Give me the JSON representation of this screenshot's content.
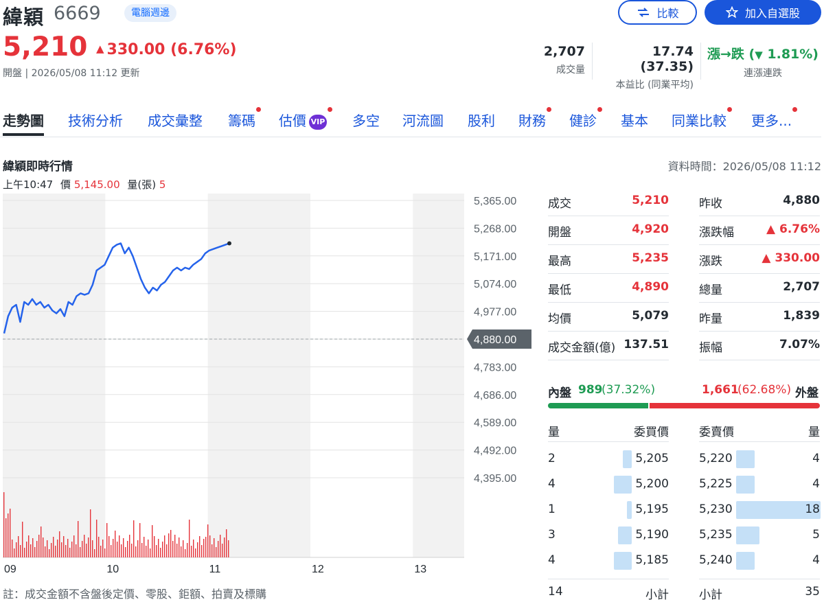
{
  "header": {
    "name": "緯穎",
    "code": "6669",
    "category": "電腦週邊",
    "price": "5,210",
    "change_arrow": "▲",
    "change": "330.00 (6.76%)",
    "open_status": "開盤 | 2026/05/08 11:12 更新",
    "compare_label": "比較",
    "watch_label": "加入自選股",
    "volume_value": "2,707",
    "volume_label": "成交量",
    "pe_value": "17.74 (37.35)",
    "pe_label": "本益比 (同業平均)",
    "streak_value_a": "漲→跌 (",
    "streak_arrow": "▼",
    "streak_value_b": " 1.81%)",
    "streak_label": "連漲連跌"
  },
  "tabs": [
    {
      "label": "走勢圖",
      "active": true,
      "dot": false
    },
    {
      "label": "技術分析",
      "dot": false
    },
    {
      "label": "成交彙整",
      "dot": false
    },
    {
      "label": "籌碼",
      "dot": true
    },
    {
      "label": "估價",
      "dot": true,
      "badge": "VIP"
    },
    {
      "label": "多空",
      "dot": false
    },
    {
      "label": "河流圖",
      "dot": false
    },
    {
      "label": "股利",
      "dot": false
    },
    {
      "label": "財務",
      "dot": true
    },
    {
      "label": "健診",
      "dot": true
    },
    {
      "label": "基本",
      "dot": false
    },
    {
      "label": "同業比較",
      "dot": true
    },
    {
      "label": "更多...",
      "dot": true
    }
  ],
  "section": {
    "title": "緯穎即時行情",
    "data_time": "資料時間：2026/05/08 11:12",
    "hover_time": "上午10:47",
    "hover_price_label": "價",
    "hover_price": "5,145.00",
    "hover_vol_label": "量(張)",
    "hover_vol": "5"
  },
  "chart_data": {
    "type": "line",
    "y_ticks": [
      "5,365.00",
      "5,268.00",
      "5,171.00",
      "5,074.00",
      "4,977.00",
      "4,880.00",
      "4,783.00",
      "4,686.00",
      "4,589.00",
      "4,492.00",
      "4,395.00"
    ],
    "x_ticks": [
      "09",
      "10",
      "11",
      "12",
      "13"
    ],
    "reference_price": 4880,
    "ylim": [
      4395,
      5365
    ],
    "line_color": "#2563eb",
    "volume_color": "#e5333a",
    "price_series": [
      4900,
      4960,
      4990,
      5000,
      4940,
      5010,
      5000,
      5020,
      5000,
      5010,
      4990,
      5000,
      4980,
      4970,
      4985,
      4960,
      5010,
      5000,
      5030,
      5040,
      5035,
      5040,
      5070,
      5120,
      5130,
      5140,
      5170,
      5200,
      5210,
      5215,
      5180,
      5200,
      5170,
      5130,
      5090,
      5060,
      5040,
      5060,
      5050,
      5070,
      5080,
      5100,
      5120,
      5130,
      5120,
      5130,
      5125,
      5140,
      5150,
      5160,
      5180,
      5190,
      5195,
      5200,
      5205,
      5210,
      5215
    ]
  },
  "quote": {
    "rows": [
      {
        "l1": "成交",
        "v1": "5,210",
        "c1": "red",
        "l2": "昨收",
        "v2": "4,880",
        "c2": "dark"
      },
      {
        "l1": "開盤",
        "v1": "4,920",
        "c1": "red",
        "l2": "漲跌幅",
        "v2": "▲ 6.76%",
        "c2": "red"
      },
      {
        "l1": "最高",
        "v1": "5,235",
        "c1": "red",
        "l2": "漲跌",
        "v2": "▲ 330.00",
        "c2": "red"
      },
      {
        "l1": "最低",
        "v1": "4,890",
        "c1": "red",
        "l2": "總量",
        "v2": "2,707",
        "c2": "dark"
      },
      {
        "l1": "均價",
        "v1": "5,079",
        "c1": "dark",
        "l2": "昨量",
        "v2": "1,839",
        "c2": "dark"
      },
      {
        "l1": "成交金額(億)",
        "v1": "137.51",
        "c1": "dark",
        "l2": "振幅",
        "v2": "7.07%",
        "c2": "dark"
      }
    ],
    "inner_label": "內盤",
    "inner_value": "989",
    "inner_pct": "(37.32%)",
    "outer_value": "1,661",
    "outer_pct": "(62.68%)",
    "outer_label": "外盤",
    "inner_ratio": 0.3732,
    "book_headers": {
      "bid_qty": "量",
      "bid_price": "委買價",
      "ask_price": "委賣價",
      "ask_qty": "量"
    },
    "book": [
      {
        "bq": "2",
        "bp": "5,205",
        "ap": "5,220",
        "aq": "4"
      },
      {
        "bq": "4",
        "bp": "5,200",
        "ap": "5,225",
        "aq": "4"
      },
      {
        "bq": "1",
        "bp": "5,195",
        "ap": "5,230",
        "aq": "18"
      },
      {
        "bq": "3",
        "bp": "5,190",
        "ap": "5,235",
        "aq": "5"
      },
      {
        "bq": "4",
        "bp": "5,185",
        "ap": "5,240",
        "aq": "4"
      }
    ],
    "bid_total": "14",
    "bid_total_label": "小計",
    "ask_total_label": "小計",
    "ask_total": "35"
  },
  "note": "註：成交金額不含盤後定價、零股、鉅額、拍賣及標購"
}
